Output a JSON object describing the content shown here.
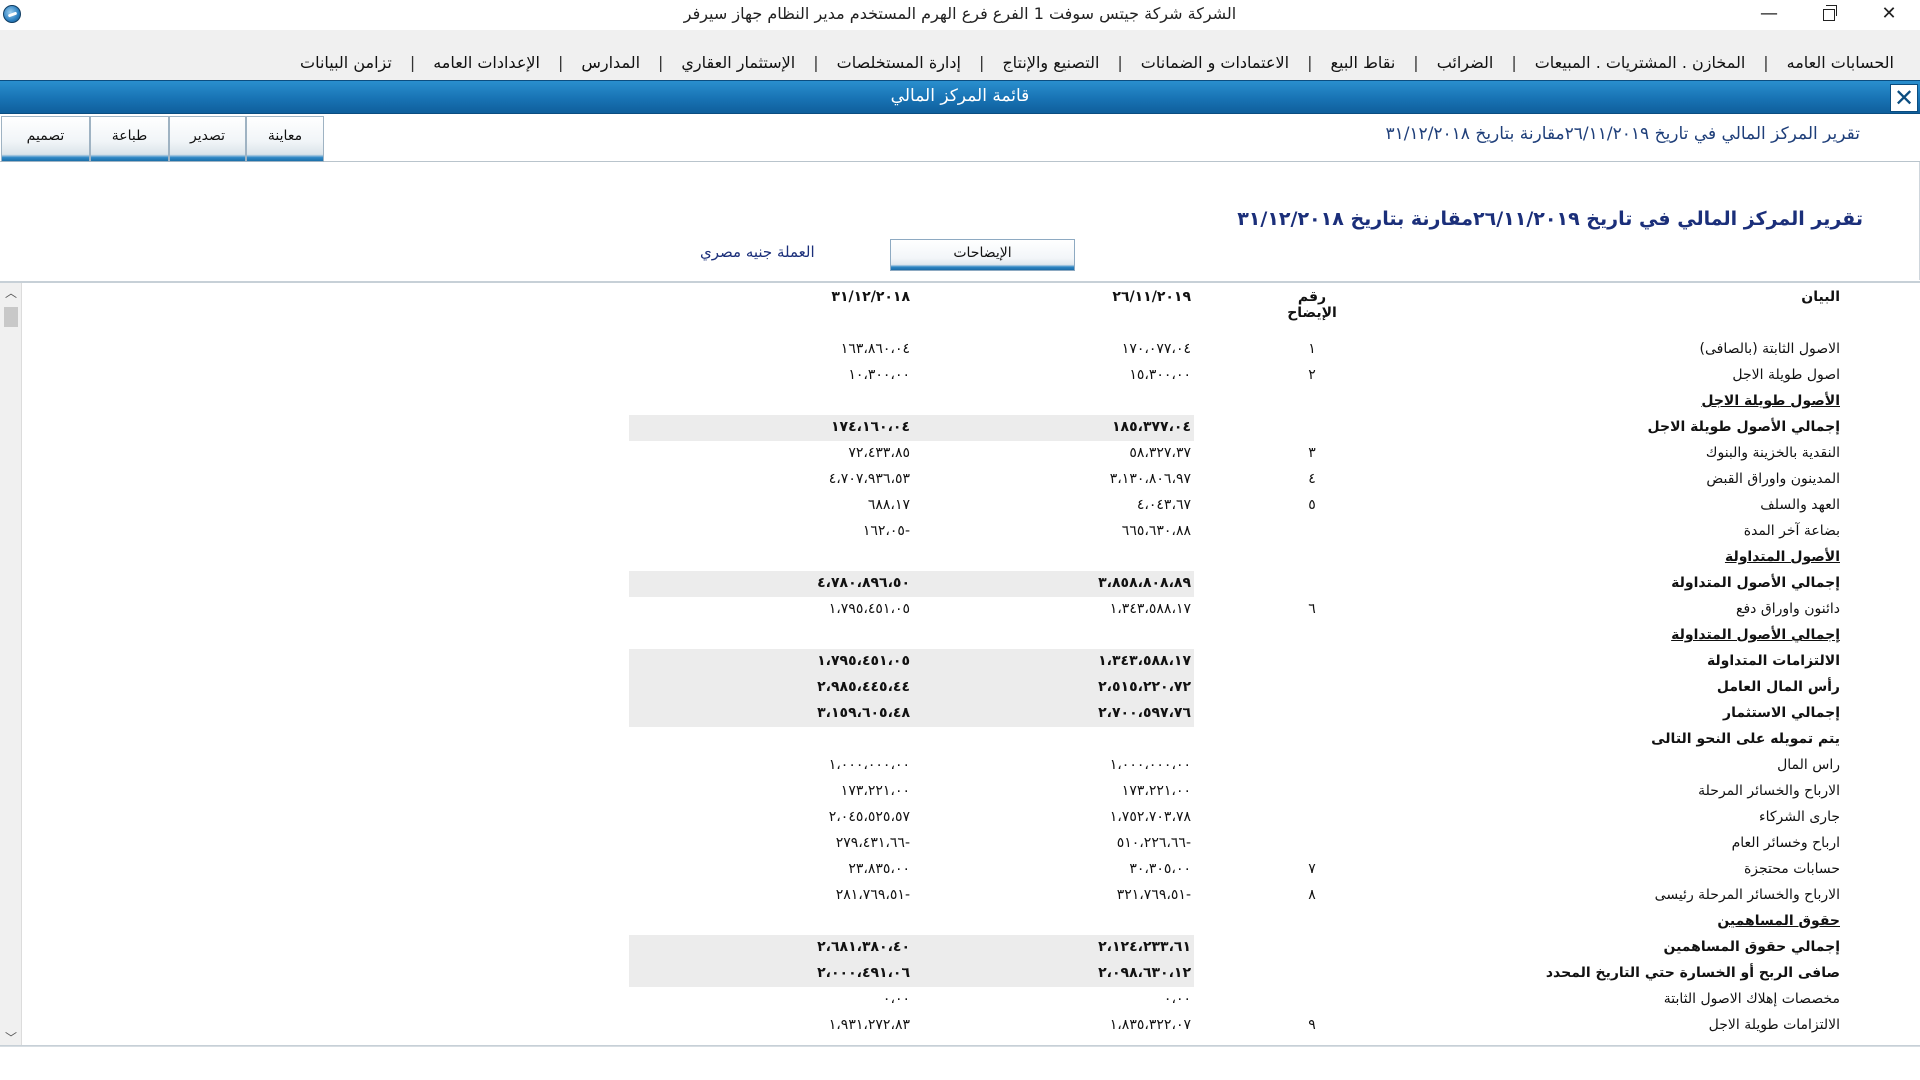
{
  "titlebar": {
    "title": "الشركة شركة جيتس سوفت 1   الفرع فرع الهرم   المستخدم مدير النظام  جهاز سيرفر",
    "minimize": "—",
    "close": "✕"
  },
  "menu": {
    "items": [
      "الحسابات العامه",
      "المخازن . المشتريات . المبيعات",
      "الضرائب",
      "نقاط البيع",
      "الاعتمادات و الضمانات",
      "التصنيع والإنتاج",
      "إدارة المستخلصات",
      "الإستثمار العقاري",
      "المدارس",
      "الإعدادات العامه",
      "تزامن البيانات"
    ],
    "separator": "|"
  },
  "header": {
    "title": "قائمة المركز المالي",
    "close": "✕"
  },
  "toolbar": {
    "design": "تصميم",
    "print": "طباعة",
    "export": "تصدير",
    "preview": "معاينة",
    "subtitle": "تقرير المركز المالي في تاريخ ٢٦/١١/٢٠١٩مقارنة بتاريخ ٣١/١٢/٢٠١٨"
  },
  "report": {
    "title": "تقرير المركز المالي في تاريخ ٢٦/١١/٢٠١٩مقارنة بتاريخ ٣١/١٢/٢٠١٨",
    "notes_button": "الإيضاحات",
    "currency": "العملة جنيه مصري"
  },
  "table": {
    "headers": {
      "label": "البيان",
      "note": "رقم الإيضاح",
      "v1": "٢٦/١١/٢٠١٩",
      "v2": "٣١/١٢/٢٠١٨"
    },
    "rows": [
      {
        "label": "الاصول الثابتة (بالصافى)",
        "note": "١",
        "v1": "١٧٠،٠٧٧،٠٤",
        "v2": "١٦٣،٨٦٠،٠٤",
        "style": "normal"
      },
      {
        "label": "اصول طويلة الاجل",
        "note": "٢",
        "v1": "١٥،٣٠٠،٠٠",
        "v2": "١٠،٣٠٠،٠٠",
        "style": "normal"
      },
      {
        "label": "الأصول طويلة الاجل",
        "note": "",
        "v1": "",
        "v2": "",
        "style": "underline"
      },
      {
        "label": "إجمالي الأصول طويلة الاجل",
        "note": "",
        "v1": "١٨٥،٣٧٧،٠٤",
        "v2": "١٧٤،١٦٠،٠٤",
        "style": "bold"
      },
      {
        "label": "النقدية بالخزينة والبنوك",
        "note": "٣",
        "v1": "٥٨،٣٢٧،٣٧",
        "v2": "٧٢،٤٣٣،٨٥",
        "style": "normal"
      },
      {
        "label": "المدينون واوراق القبض",
        "note": "٤",
        "v1": "٣،١٣٠،٨٠٦،٩٧",
        "v2": "٤،٧٠٧،٩٣٦،٥٣",
        "style": "normal"
      },
      {
        "label": "العهد والسلف",
        "note": "٥",
        "v1": "٤،٠٤٣،٦٧",
        "v2": "٦٨٨،١٧",
        "style": "normal"
      },
      {
        "label": "بضاعة آخر المدة",
        "note": "",
        "v1": "٦٦٥،٦٣٠،٨٨",
        "v2": "١٦٢،٠٥-",
        "style": "normal"
      },
      {
        "label": "الأصول المتداولة",
        "note": "",
        "v1": "",
        "v2": "",
        "style": "underline"
      },
      {
        "label": "إجمالي الأصول المتداولة",
        "note": "",
        "v1": "٣،٨٥٨،٨٠٨،٨٩",
        "v2": "٤،٧٨٠،٨٩٦،٥٠",
        "style": "bold"
      },
      {
        "label": "دائنون واوراق دفع",
        "note": "٦",
        "v1": "١،٣٤٣،٥٨٨،١٧",
        "v2": "١،٧٩٥،٤٥١،٠٥",
        "style": "normal"
      },
      {
        "label": "إجمالي الأصول المتداولة",
        "note": "",
        "v1": "",
        "v2": "",
        "style": "underline"
      },
      {
        "label": "الالتزامات المتداولة",
        "note": "",
        "v1": "١،٣٤٣،٥٨٨،١٧",
        "v2": "١،٧٩٥،٤٥١،٠٥",
        "style": "bold"
      },
      {
        "label": "رأس المال العامل",
        "note": "",
        "v1": "٢،٥١٥،٢٢٠،٧٢",
        "v2": "٢،٩٨٥،٤٤٥،٤٤",
        "style": "bold"
      },
      {
        "label": "إجمالي الاستثمار",
        "note": "",
        "v1": "٢،٧٠٠،٥٩٧،٧٦",
        "v2": "٣،١٥٩،٦٠٥،٤٨",
        "style": "bold"
      },
      {
        "label": "يتم تمويله على النحو التالى",
        "note": "",
        "v1": "",
        "v2": "",
        "style": "boldlabel"
      },
      {
        "label": "راس المال",
        "note": "",
        "v1": "١،٠٠٠،٠٠٠،٠٠",
        "v2": "١،٠٠٠،٠٠٠،٠٠",
        "style": "normal"
      },
      {
        "label": "الارباح والخسائر المرحلة",
        "note": "",
        "v1": "١٧٣،٢٢١،٠٠",
        "v2": "١٧٣،٢٢١،٠٠",
        "style": "normal"
      },
      {
        "label": "جارى الشركاء",
        "note": "",
        "v1": "١،٧٥٢،٧٠٣،٧٨",
        "v2": "٢،٠٤٥،٥٢٥،٥٧",
        "style": "normal"
      },
      {
        "label": "ارباح وخسائر العام",
        "note": "",
        "v1": "٥١٠،٢٢٦،٦٦-",
        "v2": "٢٧٩،٤٣١،٦٦-",
        "style": "normal"
      },
      {
        "label": "حسابات محتجزة",
        "note": "٧",
        "v1": "٣٠،٣٠٥،٠٠",
        "v2": "٢٣،٨٣٥،٠٠",
        "style": "normal"
      },
      {
        "label": "الارباح والخسائر المرحلة رئيسى",
        "note": "٨",
        "v1": "٣٢١،٧٦٩،٥١-",
        "v2": "٢٨١،٧٦٩،٥١-",
        "style": "normal"
      },
      {
        "label": "حقوق المساهمين",
        "note": "",
        "v1": "",
        "v2": "",
        "style": "underline"
      },
      {
        "label": "إجمالي حقوق المساهمين",
        "note": "",
        "v1": "٢،١٢٤،٢٣٣،٦١",
        "v2": "٢،٦٨١،٣٨٠،٤٠",
        "style": "bold"
      },
      {
        "label": "صافى الربح أو الخسارة حتي التاريخ المحدد",
        "note": "",
        "v1": "٢،٠٩٨،٦٣٠،١٢",
        "v2": "٢،٠٠٠،٤٩١،٠٦",
        "style": "bold"
      },
      {
        "label": "مخصصات إهلاك الاصول الثابتة",
        "note": "",
        "v1": "٠،٠٠",
        "v2": "٠،٠٠",
        "style": "normal"
      },
      {
        "label": "الالتزامات طويلة الاجل",
        "note": "٩",
        "v1": "١،٨٣٥،٣٢٢،٠٧",
        "v2": "١،٩٣١،٢٧٢،٨٣",
        "style": "normal"
      }
    ]
  }
}
